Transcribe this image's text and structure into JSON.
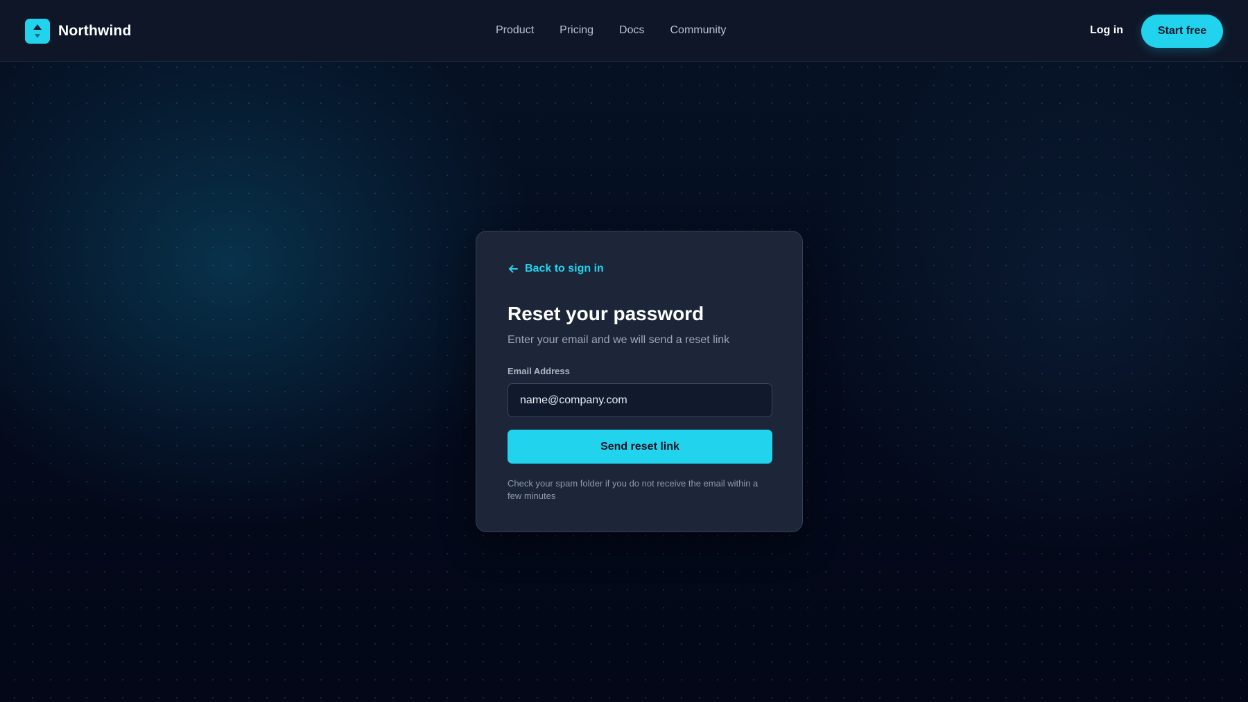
{
  "header": {
    "brand": {
      "name": "Northwind",
      "logo_icon": "northwind-logo-icon"
    },
    "nav": [
      {
        "label": "Product"
      },
      {
        "label": "Pricing"
      },
      {
        "label": "Docs"
      },
      {
        "label": "Community"
      }
    ],
    "login_label": "Log in",
    "cta_label": "Start free"
  },
  "card": {
    "back_link": {
      "label": "Back to sign in",
      "icon": "arrow-left-icon"
    },
    "title": "Reset your password",
    "subtitle": "Enter your email and we will send a reset link",
    "email": {
      "label": "Email Address",
      "value": "",
      "placeholder": "name@company.com"
    },
    "submit_label": "Send reset link",
    "help_text": "Check your spam folder if you do not receive the email within a few minutes"
  },
  "colors": {
    "accent": "#22d3ee",
    "background": "#050a1a",
    "header_bg": "#0e1628",
    "card_bg": "#1c2638"
  }
}
